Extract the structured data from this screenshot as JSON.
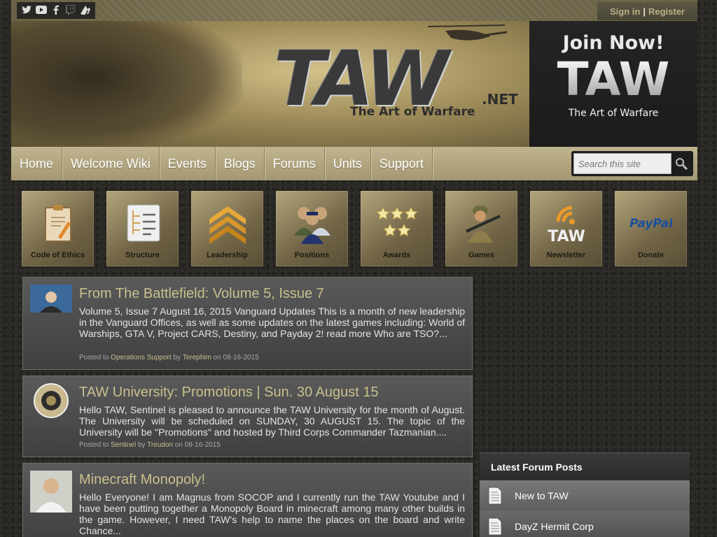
{
  "social": {
    "icons": [
      "twitter-icon",
      "youtube-icon",
      "facebook-icon",
      "twitch-icon",
      "taw-icon"
    ]
  },
  "auth": {
    "signin": "Sign in",
    "separator": "|",
    "register": "Register"
  },
  "banner": {
    "logo": "TAW",
    "net": ".NET",
    "tagline": "The Art of Warfare"
  },
  "join": {
    "line1": "Join Now!",
    "line2": "TAW",
    "line3": "The Art of Warfare"
  },
  "nav": {
    "items": [
      "Home",
      "Welcome Wiki",
      "Events",
      "Blogs",
      "Forums",
      "Units",
      "Support"
    ]
  },
  "search": {
    "placeholder": "Search this site"
  },
  "tiles": [
    {
      "label": "Code of Ethics",
      "icon": "clipboard-icon"
    },
    {
      "label": "Structure",
      "icon": "structure-icon"
    },
    {
      "label": "Leadership",
      "icon": "chevron-rank-icon"
    },
    {
      "label": "Positions",
      "icon": "people-icon"
    },
    {
      "label": "Awards",
      "icon": "stars-icon"
    },
    {
      "label": "Games",
      "icon": "soldier-icon"
    },
    {
      "label": "Newsletter",
      "icon": "rss-icon"
    },
    {
      "label": "Donate",
      "icon": "paypal-icon"
    }
  ],
  "newsletter_tile_text": "TAW",
  "paypal_text": "PayPal",
  "posts": [
    {
      "title": "From The Battlefield: Volume 5, Issue 7",
      "body": "Volume 5, Issue 7 August 16, 2015 Vanguard Updates This is a month of new leadership in the Vanguard Offices, as well as some updates on the latest games including: World of Warships, GTA V, Project CARS, Destiny, and Payday 2! read more Who are TSO?...",
      "meta_prefix": "Posted to",
      "category": "Operations Support",
      "by": "by",
      "author": "Terephim",
      "on": "on 08-16-2015"
    },
    {
      "title": "TAW University: Promotions | Sun. 30 August 15",
      "body": "Hello TAW, Sentinel is pleased to announce the TAW University for the month of August. The University will be scheduled on SUNDAY, 30 AUGUST 15. The topic of the University will be \"Promotions\" and hosted by Third Corps Commander Tazmanian....",
      "meta_prefix": "Posted to",
      "category": "Sentinel",
      "by": "by",
      "author": "Treudon",
      "on": "on 08-16-2015"
    },
    {
      "title": "Minecraft Monopoly!",
      "body": "Hello Everyone! I am Magnus from SOCOP and I currently run the TAW Youtube and I have been putting together a Monopoly Board in minecraft among many other builds in the game. However, I need TAW's help to name the places on the board and write Chance..."
    }
  ],
  "sidebar": {
    "title": "Latest Forum Posts",
    "items": [
      "New to TAW",
      "DayZ Hermit Corp"
    ]
  }
}
